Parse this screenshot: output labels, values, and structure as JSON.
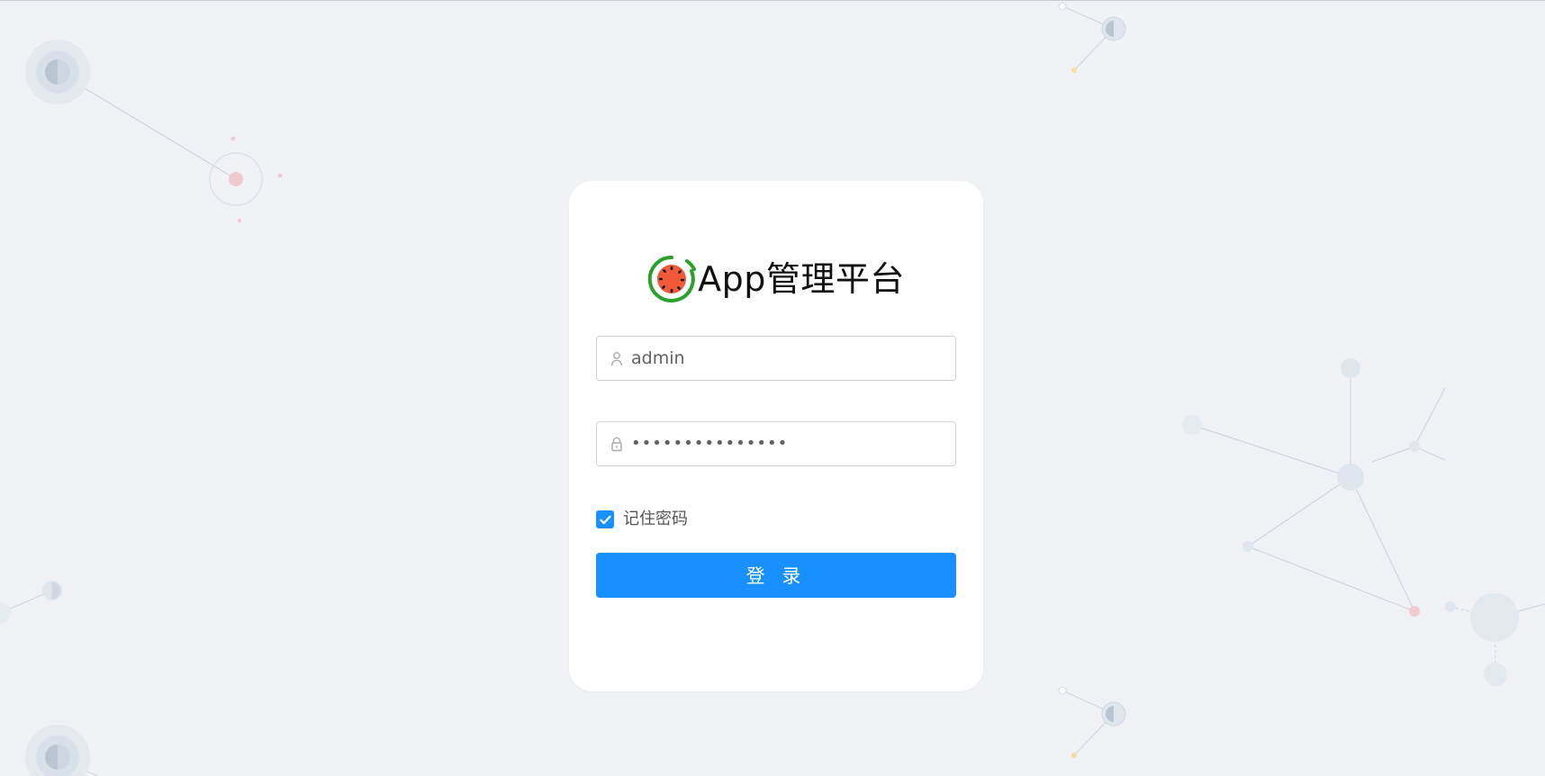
{
  "brand": {
    "title": "App管理平台",
    "logo_icon": "watermelon-logo-icon"
  },
  "login": {
    "username_value": "admin",
    "password_mask": "•••••••••••••••",
    "remember_label": "记住密码",
    "remember_checked": true,
    "submit_label": "登 录",
    "icons": {
      "username": "user-icon",
      "password": "lock-icon",
      "remember": "check-icon"
    }
  },
  "colors": {
    "background": "#f0f2f6",
    "card": "#ffffff",
    "primary": "#1890ff",
    "input_border": "#cfd4dc",
    "title_text": "#111111",
    "body_text": "#606266",
    "logo_green": "#2aa12a",
    "logo_red": "#f05a3a"
  }
}
